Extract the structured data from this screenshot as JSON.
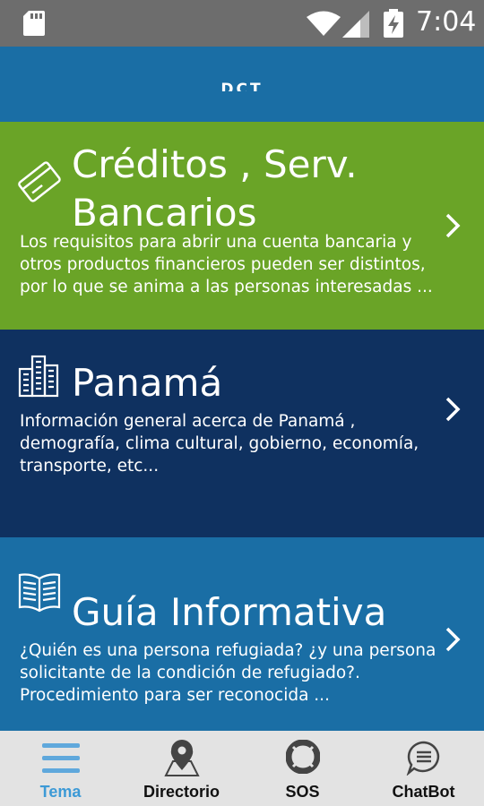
{
  "status_bar": {
    "time": "7:04"
  },
  "app_bar": {
    "logo_text": "DCT"
  },
  "cards": [
    {
      "title_line1": "Créditos , Serv.",
      "title_line2": "Bancarios",
      "description": "Los requisitos para abrir una cuenta bancaria y otros productos financieros pueden ser distintos, por lo que se anima a las personas interesadas ...",
      "icon": "credit-card-icon",
      "color": "#6aa427"
    },
    {
      "title": "Panamá",
      "description": "Información general acerca de Panamá , demografía, clima cultural, gobierno, economía, transporte, etc...",
      "icon": "buildings-icon",
      "color": "#0f3160"
    },
    {
      "title": "Guía Informativa",
      "description": "¿Quién es una persona refugiada? ¿y una persona solicitante de la condición de refugiado?. Procedimiento para ser reconocida ...",
      "icon": "book-icon",
      "color": "#1a6ea5"
    }
  ],
  "bottom_nav": {
    "items": [
      {
        "label": "Tema",
        "icon": "menu-icon",
        "active": true
      },
      {
        "label": "Directorio",
        "icon": "map-pin-icon",
        "active": false
      },
      {
        "label": "SOS",
        "icon": "lifebuoy-icon",
        "active": false
      },
      {
        "label": "ChatBot",
        "icon": "chat-icon",
        "active": false
      }
    ]
  }
}
